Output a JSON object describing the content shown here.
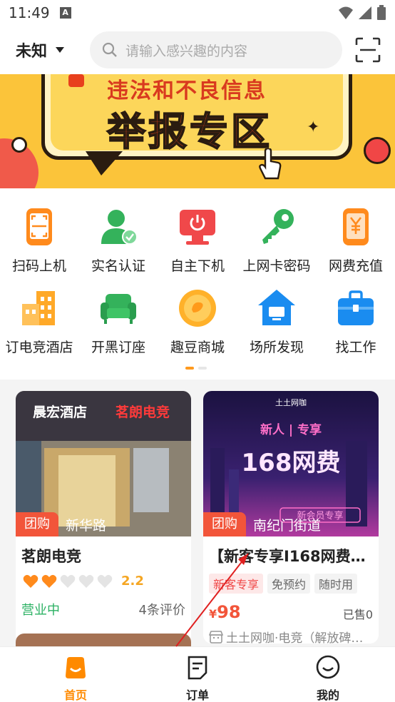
{
  "status_bar": {
    "time": "11:49",
    "notif_letter": "A"
  },
  "header": {
    "city": "未知",
    "search_placeholder": "请输入感兴趣的内容"
  },
  "banner": {
    "line1": "违法和不良信息",
    "line2": "举报专区"
  },
  "grid": {
    "items": [
      {
        "label": "扫码上机",
        "icon": "scan-phone-icon"
      },
      {
        "label": "实名认证",
        "icon": "verified-user-icon"
      },
      {
        "label": "自主下机",
        "icon": "power-monitor-icon"
      },
      {
        "label": "上网卡密码",
        "icon": "key-icon"
      },
      {
        "label": "网费充值",
        "icon": "yuan-phone-icon"
      },
      {
        "label": "订电竞酒店",
        "icon": "hotel-building-icon"
      },
      {
        "label": "开黑订座",
        "icon": "sofa-icon"
      },
      {
        "label": "趣豆商城",
        "icon": "coin-mall-icon"
      },
      {
        "label": "场所发现",
        "icon": "venue-house-icon"
      },
      {
        "label": "找工作",
        "icon": "briefcase-icon"
      }
    ]
  },
  "shops": [
    {
      "tag": "团购",
      "street": "新华路",
      "name": "茗朗电竞",
      "rating": "2.2",
      "hearts_filled": 2,
      "hearts_total": 5,
      "status": "营业中",
      "reviews": "4条评价",
      "img_sign1": "晨宏酒店",
      "img_sign2": "茗朗电竞"
    },
    {
      "tag": "团购",
      "street": "南纪门街道",
      "name": "【新客专享I168网费…",
      "tags": [
        "新客专享",
        "免预约",
        "随时用"
      ],
      "price_symbol": "¥",
      "price": "98",
      "sold": "已售0",
      "merchant": "土土网咖·电竞（解放碑…",
      "img_brand": "土土网咖",
      "img_text1": "新人 | 专享",
      "img_text2": "168网费",
      "img_text3": "新会员专享"
    }
  ],
  "bottom_nav": [
    {
      "label": "首页",
      "icon": "home-bag-icon",
      "active": true
    },
    {
      "label": "订单",
      "icon": "order-doc-icon",
      "active": false
    },
    {
      "label": "我的",
      "icon": "profile-smile-icon",
      "active": false
    }
  ],
  "colors": {
    "accent": "#ff8a00",
    "red": "#f2553a",
    "green": "#2bb163",
    "banner_bg": "#fbc43a"
  }
}
